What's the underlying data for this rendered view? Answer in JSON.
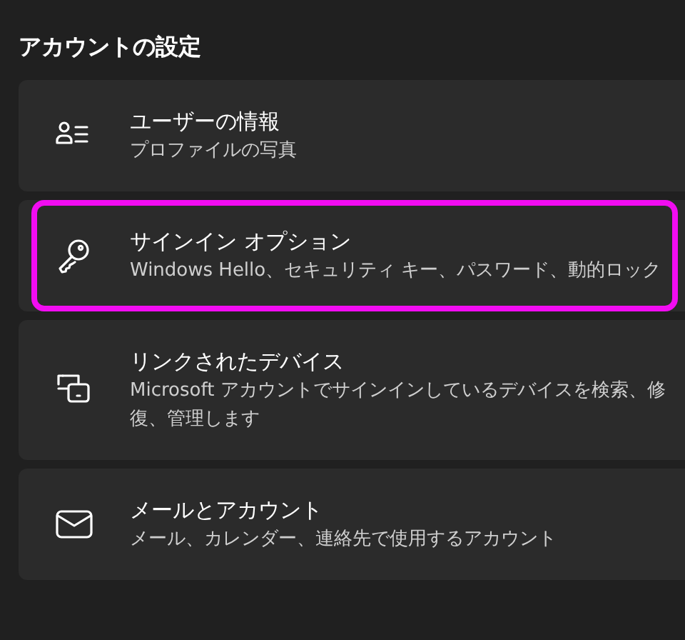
{
  "section_title": "アカウントの設定",
  "items": [
    {
      "title": "ユーザーの情報",
      "description": [
        "プロファイルの写真"
      ],
      "highlighted": false
    },
    {
      "title": "サインイン オプション",
      "description": [
        "Windows Hello、セキュリティ キー、パスワード、動的ロック"
      ],
      "highlighted": true
    },
    {
      "title": "リンクされたデバイス",
      "description": [
        "Microsoft アカウントでサインインしているデバイスを検索、修",
        "復、管理します"
      ],
      "highlighted": false
    },
    {
      "title": "メールとアカウント",
      "description": [
        "メール、カレンダー、連絡先で使用するアカウント"
      ],
      "highlighted": false
    }
  ]
}
